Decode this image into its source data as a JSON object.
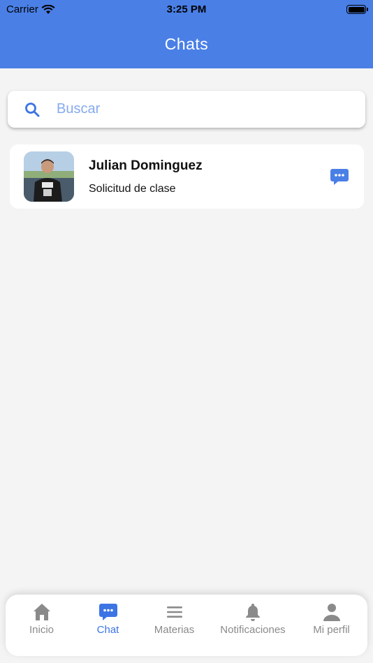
{
  "status_bar": {
    "carrier": "Carrier",
    "time": "3:25 PM"
  },
  "header": {
    "title": "Chats"
  },
  "search": {
    "placeholder": "Buscar"
  },
  "chats": [
    {
      "name": "Julian Dominguez",
      "preview": "Solicitud de clase",
      "action_icon": "chat-bubble-icon"
    }
  ],
  "bottom_nav": {
    "items": [
      {
        "label": "Inicio",
        "icon": "home-icon",
        "active": false
      },
      {
        "label": "Chat",
        "icon": "chat-icon",
        "active": true
      },
      {
        "label": "Materias",
        "icon": "menu-icon",
        "active": false
      },
      {
        "label": "Notificaciones",
        "icon": "bell-icon",
        "active": false
      },
      {
        "label": "Mi perfil",
        "icon": "user-icon",
        "active": false
      }
    ]
  },
  "colors": {
    "primary": "#4a7fe6",
    "active_nav": "#3d74e4",
    "inactive_nav": "#8a8a8a",
    "background": "#f4f4f4"
  }
}
